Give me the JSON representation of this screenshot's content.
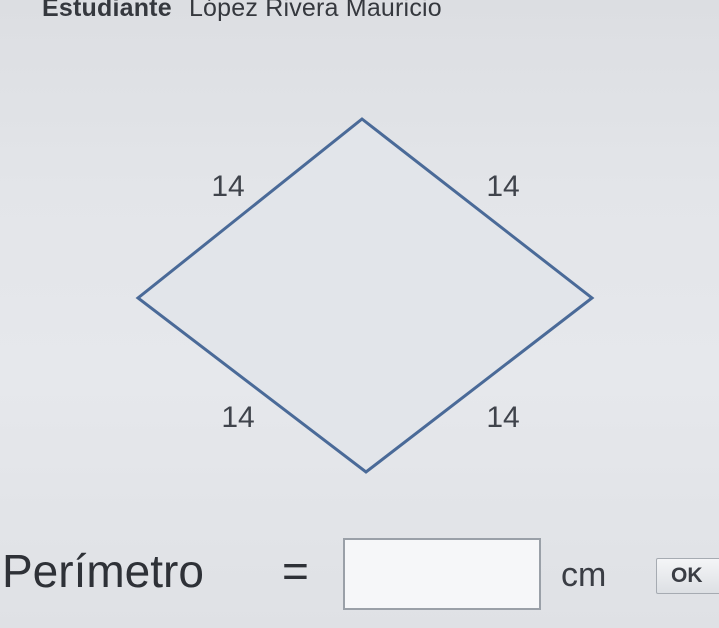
{
  "student": {
    "label": "Estudiante",
    "name": "López Rivera Mauricio"
  },
  "figure": {
    "shape": "rhombus",
    "stroke_color": "#4a6a98",
    "fill_color": "#e2e5ea",
    "side_labels": [
      "14",
      "14",
      "14",
      "14"
    ]
  },
  "answer": {
    "label": "Perímetro",
    "equals": "=",
    "value": "",
    "unit": "cm",
    "submit_label": "OK"
  }
}
